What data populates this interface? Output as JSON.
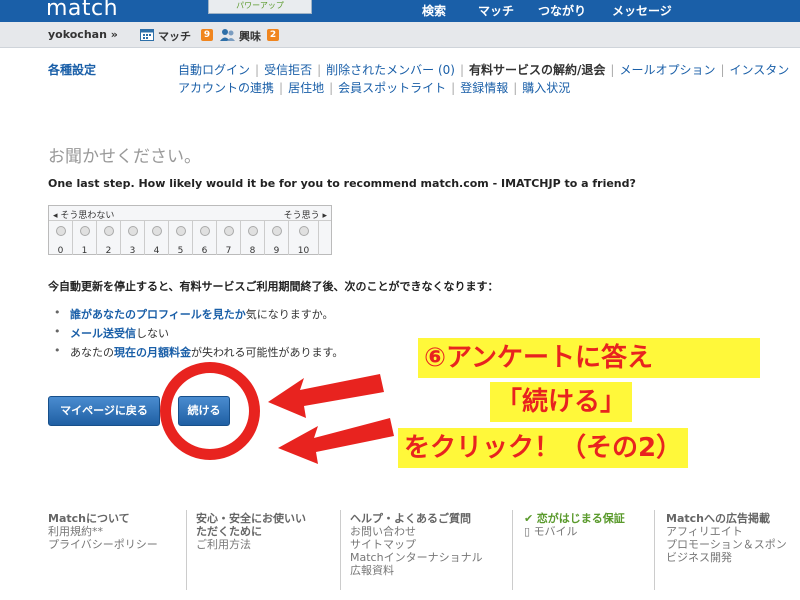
{
  "header": {
    "logo": "match",
    "powerup": "パワーアップ",
    "nav": [
      "検索",
      "マッチ",
      "つながり",
      "メッセージ"
    ]
  },
  "subbar": {
    "username": "yokochan »",
    "match_label": "マッチ",
    "match_count": "9",
    "interest_label": "興味",
    "interest_count": "2",
    "icons": [
      "calendar-icon",
      "people-icon"
    ]
  },
  "settings": {
    "title": "各種設定",
    "row1": [
      "自動ログイン",
      "受信拒否",
      "削除されたメンバー (0)",
      "有料サービスの解約/退会",
      "メールオプション",
      "インスタン"
    ],
    "row2": [
      "アカウントの連携",
      "居住地",
      "会員スポットライト",
      "登録情報",
      "購入状況"
    ],
    "current": "有料サービスの解約/退会"
  },
  "survey": {
    "title": "お聞かせください。",
    "question": "One last step. How likely would it be for you to recommend match.com - IMATCHJP to a friend?",
    "left_label": "◂ そう思わない",
    "right_label": "そう思う ▸",
    "options": [
      "0",
      "1",
      "2",
      "3",
      "4",
      "5",
      "6",
      "7",
      "8",
      "9",
      "10"
    ]
  },
  "notice": {
    "text": "今自動更新を停止すると、有料サービスご利用期間終了後、次のことができなくなります：",
    "b1_hl": "誰があなたのプロフィールを見たか",
    "b1_rest": "気になりますか。",
    "b2_hl": "メール送受信",
    "b2_rest": "しない",
    "b3_pre": "あなたの",
    "b3_hl": "現在の月額料金",
    "b3_rest": "が失われる可能性があります。"
  },
  "buttons": {
    "back": "マイページに戻る",
    "continue": "続ける"
  },
  "annotation": {
    "line1": "⑥アンケートに答え",
    "line2": "「続ける」",
    "line3": "をクリック！（その2）"
  },
  "footer": {
    "col1": [
      "Matchについて",
      "利用規約**",
      "プライバシーポリシー"
    ],
    "col2": [
      "安心・安全にお使いい",
      "ただくために",
      "ご利用方法"
    ],
    "col3": [
      "ヘルプ・よくあるご質問",
      "お問い合わせ",
      "サイトマップ",
      "Matchインターナショナル",
      "広報資料"
    ],
    "col4": [
      "恋がはじまる保証",
      "モバイル"
    ],
    "col5": [
      "Matchへの広告掲載",
      "アフィリエイト",
      "プロモーション＆スポン",
      "ビジネス開発"
    ]
  },
  "colors": {
    "brand": "#1a5fa8",
    "accent_red": "#e8231f",
    "highlight_yellow": "#fff83a",
    "badge_orange": "#f0851e"
  }
}
